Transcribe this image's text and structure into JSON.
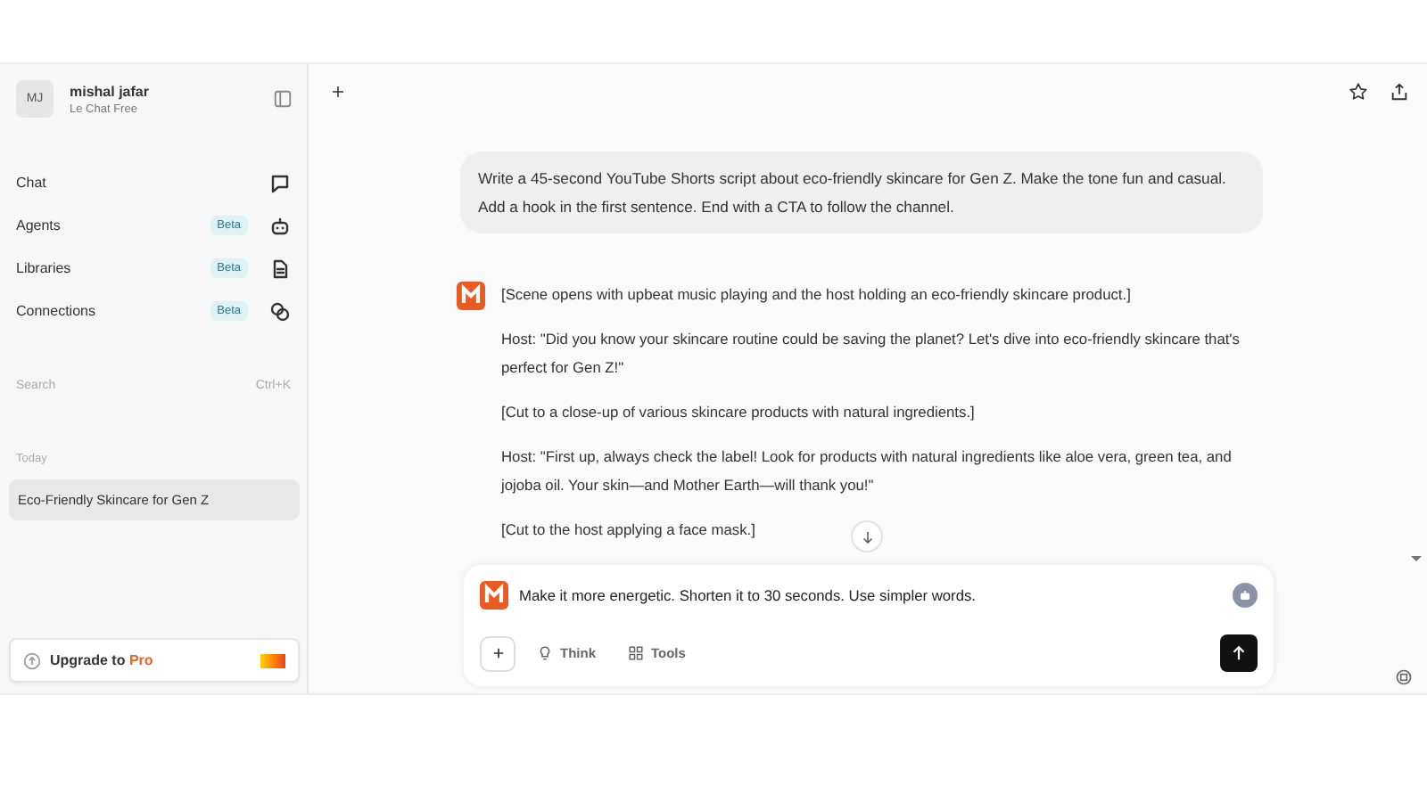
{
  "user": {
    "initials": "MJ",
    "name": "mishal jafar",
    "plan": "Le Chat Free"
  },
  "nav": [
    {
      "label": "Chat"
    },
    {
      "label": "Agents",
      "badge": "Beta"
    },
    {
      "label": "Libraries",
      "badge": "Beta"
    },
    {
      "label": "Connections",
      "badge": "Beta"
    }
  ],
  "search": {
    "placeholder": "Search",
    "shortcut": "Ctrl+K"
  },
  "history": {
    "heading": "Today",
    "items": [
      {
        "title": "Eco-Friendly Skincare for Gen Z",
        "selected": true
      }
    ]
  },
  "upgrade": {
    "label": "Upgrade to **Pro**"
  },
  "conversation": {
    "user_message": "Write a 45-second YouTube Shorts script about eco-friendly skincare for Gen Z. Make the tone fun and casual. Add a hook in the first sentence. End with a CTA to follow the channel.",
    "assistant_paragraphs": [
      "[Scene opens with upbeat music playing and the host holding an eco-friendly skincare product.]",
      "Host: \"Did you know your skincare routine could be saving the planet? Let's dive into eco-friendly skincare that's perfect for Gen Z!\"",
      "[Cut to a close-up of various skincare products with natural ingredients.]",
      "Host: \"First up, always check the label! Look for products with natural ingredients like aloe vera, green tea, and jojoba oil. Your skin—and Mother Earth—will thank you!\"",
      "[Cut to the host applying a face mask.]"
    ]
  },
  "composer": {
    "value": "Make it more energetic. Shorten it to 30 seconds. Use simpler words.",
    "tools": [
      {
        "label": "Think"
      },
      {
        "label": "Tools"
      }
    ]
  }
}
